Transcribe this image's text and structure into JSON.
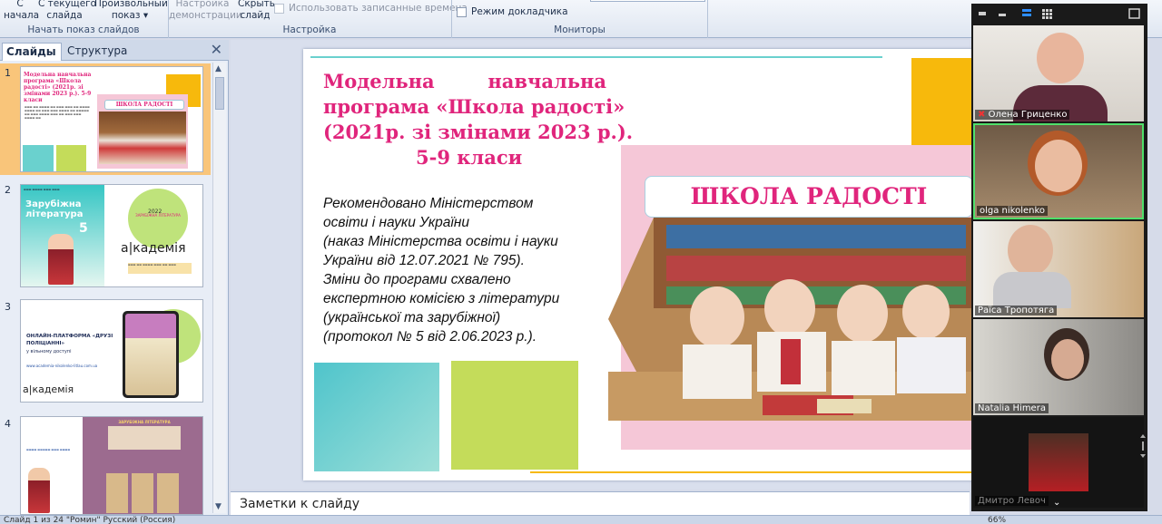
{
  "ribbon": {
    "from_start_1": "С",
    "from_start_2": "начала",
    "from_current_1": "С текущего",
    "from_current_2": "слайда",
    "custom_1": "Произвольный",
    "custom_2": "показ",
    "group_start": "Начать показ слайдов",
    "setup_1": "Настройка",
    "setup_2": "демонстрации",
    "hide_1": "Скрыть",
    "hide_2": "слайд",
    "use_timings": "Использовать записанные времена",
    "group_setup": "Настройка",
    "presenter_view": "Режим докладчика",
    "group_monitors": "Мониторы"
  },
  "panel": {
    "tab_slides": "Слайды",
    "tab_outline": "Структура",
    "close": "✕",
    "nums": [
      "1",
      "2",
      "3",
      "4"
    ]
  },
  "thumb1": {
    "title": "Модельна навчальна програма «Школа радості» (2021р. зі змінами 2023 р.). 5-9 класи",
    "badge": "ШКОЛА РАДОСТІ"
  },
  "thumb2": {
    "title": "Зарубіжна література",
    "grade": "5",
    "brand": "а|кадемія",
    "circle": "ЗАРУБІЖНА ЛІТЕРАТУРА",
    "year": "2022"
  },
  "thumb3": {
    "title": "ОНЛАЙН-ПЛАТФОРМА «ДРУЗІ ПОЛІЦІАННІ»",
    "sub": "у вільному доступі",
    "link": "www.academia-nikolenko-litlau.com.ua",
    "brand": "а|кадемія"
  },
  "thumb4": {
    "heading": "ЗАРУБІЖНА ЛІТЕРАТУРА"
  },
  "slide": {
    "title_l1": "Модельна навчальна",
    "title_l2": "програма «Школа радості»",
    "title_l3": "(2021р. зі змінами 2023 р.).",
    "title_l4": "5-9 класи",
    "body": [
      "Рекомендовано Міністерством",
      "освіти і науки України",
      "(наказ Міністерства освіти і науки",
      "України від 12.07.2021 № 795).",
      "Зміни до програми схвалено",
      "експертною комісією з літератури",
      "(української та зарубіжної)",
      "(протокол № 5 від 2.06.2023 р.)."
    ],
    "banner": "ШКОЛА РАДОСТІ"
  },
  "notes_placeholder": "Заметки к слайду",
  "status": {
    "text": "Слайд 1 из 24   \"Ромин\"   Русский (Россия)",
    "zoom": "66%"
  },
  "zoom": {
    "participants": [
      {
        "name": "Олена Гриценко"
      },
      {
        "name": "olga nikolenko"
      },
      {
        "name": "Раїса Тропотяга"
      },
      {
        "name": "Natalia Himera"
      },
      {
        "name": "Дмитро Левоч"
      }
    ]
  },
  "colors": {
    "accent": "#e0257c",
    "teal": "#6ad1ce",
    "lime": "#c4dc5a",
    "yellow": "#f7b90c",
    "pink": "#f5c7d7"
  }
}
